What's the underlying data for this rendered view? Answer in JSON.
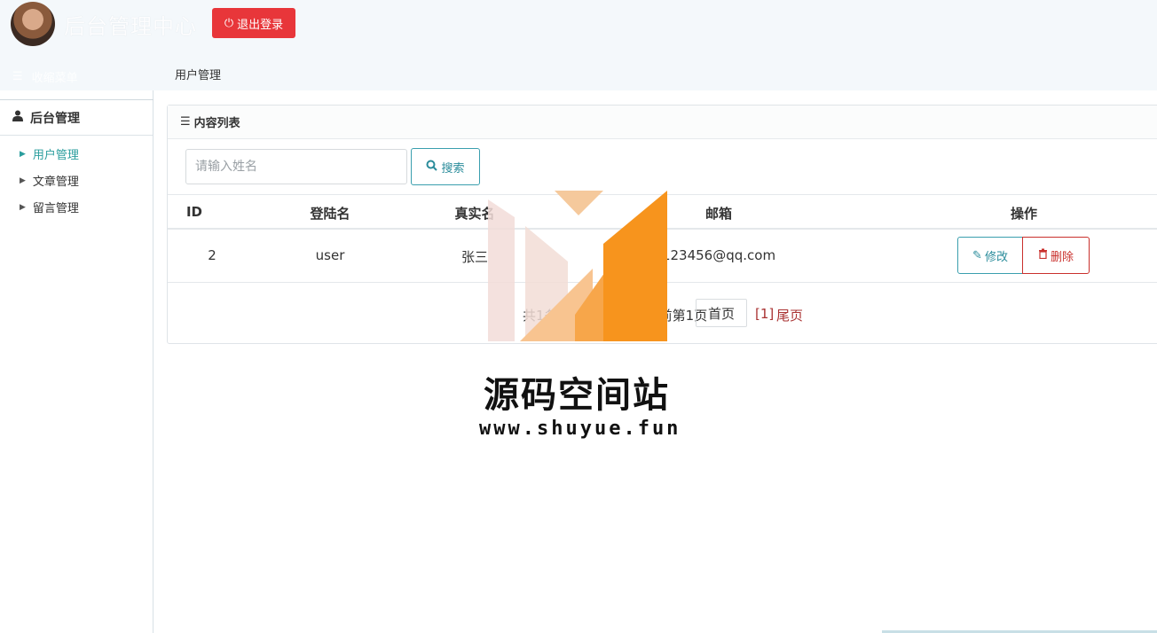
{
  "header": {
    "app_title": "后台管理中心",
    "logout_label": "退出登录",
    "nav_toggle_label": "收缩菜单",
    "breadcrumb": "用户管理"
  },
  "sidebar": {
    "group_label": "后台管理",
    "items": [
      {
        "label": "用户管理",
        "active": true
      },
      {
        "label": "文章管理",
        "active": false
      },
      {
        "label": "留言管理",
        "active": false
      }
    ]
  },
  "panel": {
    "title": "内容列表",
    "search": {
      "placeholder": "请输入姓名",
      "button_label": "搜索"
    },
    "table": {
      "columns": [
        "ID",
        "登陆名",
        "真实名",
        "邮箱",
        "操作"
      ],
      "rows": [
        {
          "id": "2",
          "login": "user",
          "realname": "张三",
          "email": "123456@qq.com",
          "edit_label": "修改",
          "delete_label": "删除"
        }
      ]
    },
    "pager": {
      "info": "共1条记录，1/1页，当前第1页",
      "first_label": "首页",
      "current": "[1]",
      "last_label": "尾页"
    }
  },
  "watermark": {
    "title": "源码空间站",
    "url": "www.shuyue.fun"
  },
  "colors": {
    "danger": "#e8363a",
    "accent": "#2a9d9d",
    "logo_orange": "#f7941d"
  }
}
